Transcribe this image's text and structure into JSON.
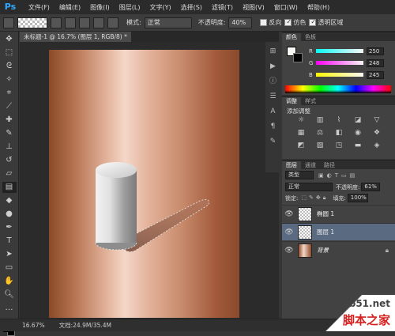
{
  "app": {
    "logo": "Ps"
  },
  "menu": [
    "文件(F)",
    "编辑(E)",
    "图像(I)",
    "图层(L)",
    "文字(Y)",
    "选择(S)",
    "滤镜(T)",
    "视图(V)",
    "窗口(W)",
    "帮助(H)"
  ],
  "options": {
    "mode_label": "模式:",
    "mode_value": "正常",
    "opacity_label": "不透明度:",
    "opacity_value": "40%",
    "reverse_label": "反向",
    "dither_label": "仿色",
    "transparency_label": "透明区域"
  },
  "document": {
    "tab_label": "未标题-1 @ 16.7% (图层 1, RGB/8) *"
  },
  "status": {
    "zoom": "16.67%",
    "doc_info": "文档:24.9M/35.4M"
  },
  "color_panel": {
    "tabs": [
      "颜色",
      "色板"
    ],
    "channels": [
      {
        "name": "R",
        "value": "250"
      },
      {
        "name": "G",
        "value": "248"
      },
      {
        "name": "B",
        "value": "245"
      }
    ]
  },
  "adjustments_panel": {
    "tabs": [
      "调整",
      "样式"
    ],
    "title": "添加调整"
  },
  "layers_panel": {
    "tabs": [
      "图层",
      "通道",
      "路径"
    ],
    "kind_label": "类型",
    "blend_mode": "正常",
    "opacity_label": "不透明度:",
    "opacity_value": "61%",
    "lock_label": "锁定:",
    "fill_label": "填充:",
    "fill_value": "100%",
    "layers": [
      {
        "name": "椭圆 1"
      },
      {
        "name": "图层 1"
      },
      {
        "name": "背景"
      }
    ]
  },
  "watermark": {
    "line1": "jb51.net",
    "line2": "脚本之家"
  },
  "colors": {
    "copper_dark": "#8a4a2a",
    "copper_light": "#f4d7c8",
    "selected_layer": "#5a6a80"
  }
}
